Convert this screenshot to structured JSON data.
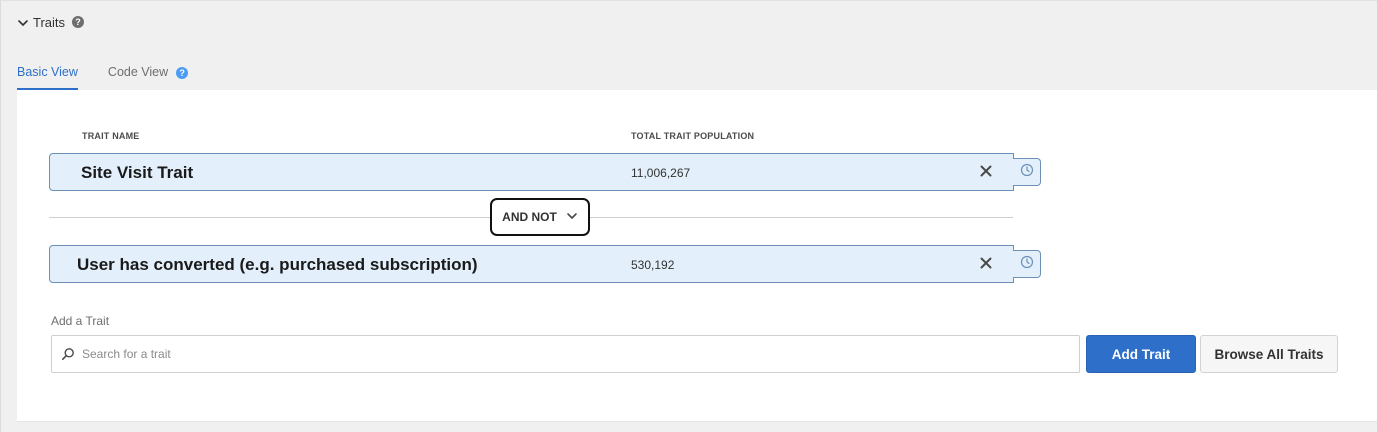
{
  "section": {
    "title": "Traits",
    "help_icon": "?"
  },
  "tabs": [
    {
      "label": "Basic View",
      "active": true
    },
    {
      "label": "Code View",
      "active": false,
      "help_icon": "?"
    }
  ],
  "columns": {
    "trait_name": "TRAIT NAME",
    "total_population": "TOTAL TRAIT POPULATION"
  },
  "traits": [
    {
      "name": "Site Visit Trait",
      "population": "11,006,267"
    },
    {
      "name": "User has converted (e.g. purchased subscription)",
      "population": "530,192"
    }
  ],
  "operator": {
    "label": "AND NOT"
  },
  "add_trait": {
    "label": "Add a Trait",
    "search_placeholder": "Search for a trait",
    "add_button": "Add Trait",
    "browse_button": "Browse All Traits"
  },
  "colors": {
    "accent": "#2d6fc9",
    "trait_bg": "#e3f0fb",
    "trait_border": "#6c90b6",
    "help_blue": "#4b9cf5"
  },
  "icons": {
    "collapse": "chevron-down-icon",
    "help": "help-icon",
    "remove": "close-icon",
    "recency": "clock-icon",
    "dropdown": "chevron-down-icon",
    "search": "search-icon"
  }
}
